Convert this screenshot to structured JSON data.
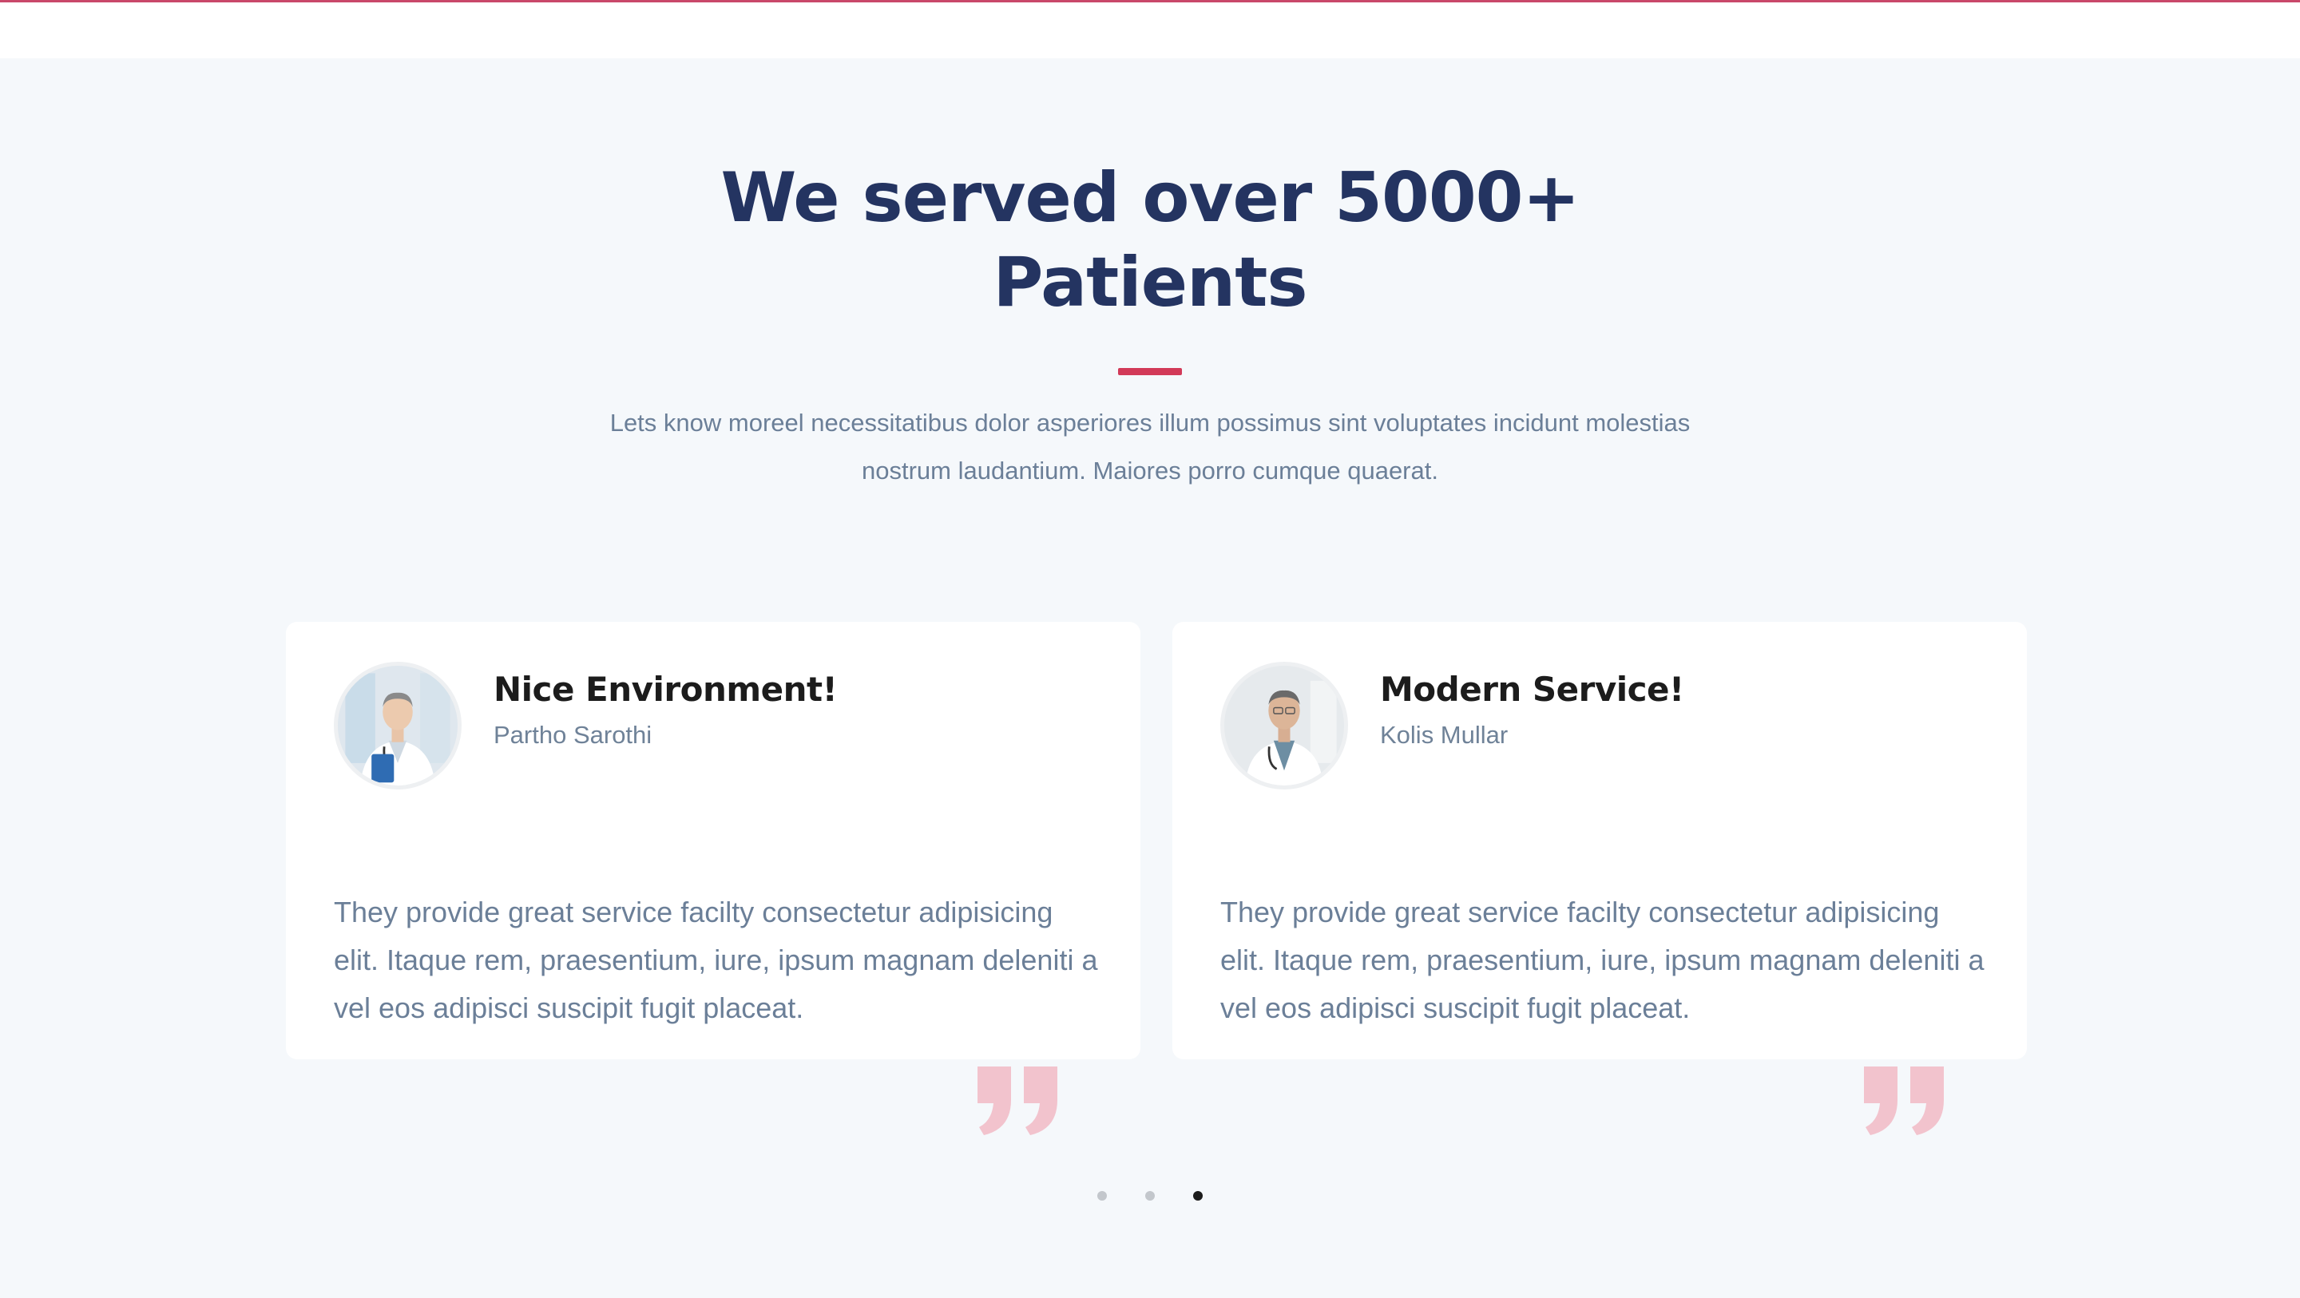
{
  "heading": {
    "line1": "We served over 5000+",
    "line2": "Patients"
  },
  "intro": "Lets know moreel necessitatibus dolor asperiores illum possimus sint voluptates incidunt molestias nostrum laudantium. Maiores porro cumque quaerat.",
  "testimonials": [
    {
      "title": "Nice Environment!",
      "author": "Partho Sarothi",
      "text": "They provide great service facilty consectetur adipisicing elit. Itaque rem, praesentium, iure, ipsum magnam deleniti a vel eos adipisci suscipit fugit placeat.",
      "avatar": "doctor-photo"
    },
    {
      "title": "Modern Service!",
      "author": "Kolis Mullar",
      "text": "They provide great service facilty consectetur adipisicing elit. Itaque rem, praesentium, iure, ipsum magnam deleniti a vel eos adipisci suscipit fugit placeat.",
      "avatar": "doctor-photo"
    }
  ],
  "carousel": {
    "total": 3,
    "active_index": 2
  },
  "icons": {
    "quote": "quote-icon"
  },
  "colors": {
    "heading": "#243461",
    "accent": "#d23a58",
    "quote": "#f2c3cd",
    "body_text": "#6b7f98",
    "section_bg": "#f5f8fb"
  }
}
